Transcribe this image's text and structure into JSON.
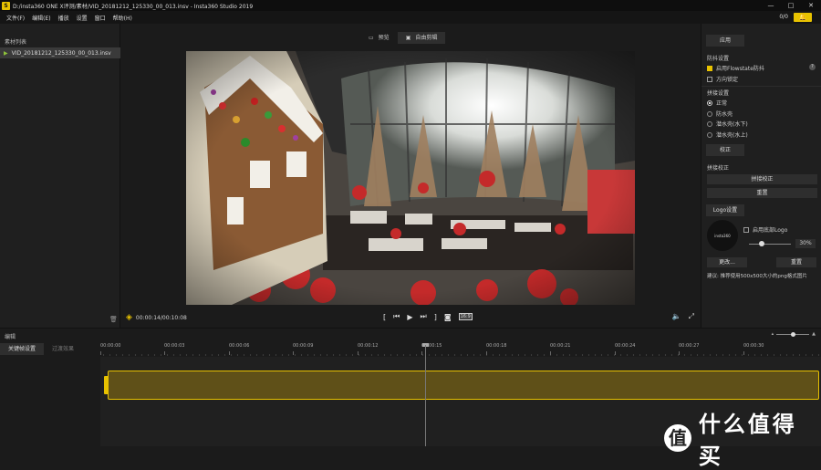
{
  "window": {
    "title": "D:/insta360 ONE X评测/素材/VID_20181212_125330_00_013.insv - Insta360 Studio 2019",
    "app_icon_letter": "S",
    "minimize": "—",
    "maximize": "□",
    "close": "✕"
  },
  "menu": [
    "文件(F)",
    "编辑(E)",
    "播放",
    "设置",
    "窗口",
    "帮助(H)"
  ],
  "toolbar": {
    "counter": "0/0",
    "notify_icon": "bell-icon"
  },
  "left_panel": {
    "title": "素材列表",
    "files": [
      {
        "name": "VID_20181212_125330_00_013.insv",
        "selected": true
      }
    ]
  },
  "view_tabs": [
    {
      "label": "预览",
      "icon": "film-icon",
      "active": false
    },
    {
      "label": "自由剪辑",
      "icon": "screen-icon",
      "active": true
    }
  ],
  "player": {
    "timecode": "00:00:14/00:10:08",
    "ratio_badge": "16:9"
  },
  "right_panel": {
    "apply_button": "应用",
    "stabilization": {
      "title": "防抖设置",
      "flowstate": {
        "label": "启用Flowstate防抖",
        "checked": true
      },
      "direction_lock": {
        "label": "方向锁定",
        "checked": false
      }
    },
    "stitching": {
      "title": "拼接设置",
      "options": [
        {
          "label": "正常",
          "selected": true
        },
        {
          "label": "防水壳",
          "selected": false
        },
        {
          "label": "潜水壳(水下)",
          "selected": false
        },
        {
          "label": "潜水壳(水上)",
          "selected": false
        }
      ]
    },
    "calibrate_button": "校正",
    "stitch_calibration": {
      "title": "拼接校正",
      "calibrate_button": "拼接校正",
      "reset_button": "重置"
    },
    "logo": {
      "title": "Logo设置",
      "thumb_text": "insta360",
      "enable_label": "启用底部Logo",
      "enabled": false,
      "size_percent": "30%",
      "size_value": 0.3,
      "change_button": "更改...",
      "reset_button": "重置",
      "hint": "建议: 推荐使用500x500大小的png格式图片"
    }
  },
  "editor": {
    "title": "编辑",
    "tabs": [
      {
        "label": "关键帧设置",
        "active": true
      },
      {
        "label": "过渡效果",
        "active": false
      }
    ],
    "ruler": [
      "00:00:00",
      "00:00:03",
      "00:00:06",
      "00:00:09",
      "00:00:12",
      "00:00:15",
      "00:00:18",
      "00:00:21",
      "00:00:24",
      "00:00:27",
      "00:00:30"
    ]
  },
  "watermark": {
    "badge": "值",
    "text": "什么值得买"
  },
  "colors": {
    "accent": "#e8c200",
    "clip": "#5f5018",
    "panel": "#1f1f1f",
    "background": "#1b1b1b"
  }
}
